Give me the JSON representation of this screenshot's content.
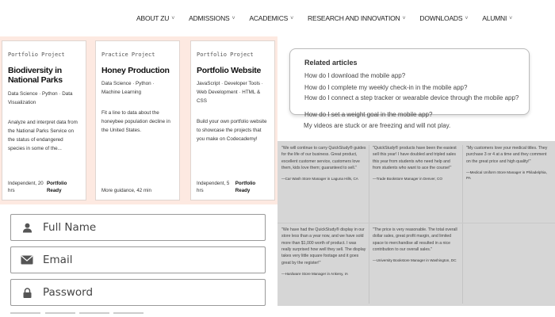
{
  "nav": {
    "items": [
      {
        "label": "ABOUT ZU"
      },
      {
        "label": "ADMISSIONS"
      },
      {
        "label": "ACADEMICS"
      },
      {
        "label": "RESEARCH AND INNOVATION"
      },
      {
        "label": "DOWNLOADS"
      },
      {
        "label": "ALUMNI"
      }
    ]
  },
  "portfolio": {
    "cards": [
      {
        "kind": "Portfolio Project",
        "title": "Biodiversity in National Parks",
        "skills": "Data Science · Python · Data Visualization",
        "desc": "Analyze and interpret data from the National Parks Service on the status of endangered species in some of the...",
        "meta": "Independent, 20 hrs",
        "badge": "Portfolio Ready"
      },
      {
        "kind": "Practice Project",
        "title": "Honey Production",
        "skills": "Data Science · Python · Machine Learning",
        "desc": "Fit a line to data about the honeybee population decline in the United States.",
        "meta": "More guidance, 42 min",
        "badge": ""
      },
      {
        "kind": "Portfolio Project",
        "title": "Portfolio Website",
        "skills": "JavaScript · Developer Tools · Web Development · HTML & CSS",
        "desc": "Build your own portfolio website to showcase the projects that you make on Codecademy!",
        "meta": "Independent, 5 hrs",
        "badge": "Portfolio Ready"
      }
    ]
  },
  "related": {
    "heading": "Related articles",
    "links": [
      "How do I download the mobile app?",
      "How do I complete my weekly check-in in the mobile app?",
      "How do I connect a step tracker or wearable device through the mobile app?",
      "How do I set a weight goal in the mobile app?",
      "My videos are stuck or are freezing and will not play."
    ]
  },
  "testimonials": [
    {
      "quote": "\"We will continue to carry QuickStudy® guides for the life of our business. Great product, excellent customer service, customers love them, kids love them; guaranteed to sell.\"",
      "sig": "—Car Wash Store Manager in Laguna Hills, CA"
    },
    {
      "quote": "\"QuickStudy® products have been the easiest sell this year! I have doubled and tripled sales this year from students who need help and from students who want to ace the course!\"",
      "sig": "—Trade Bookstore Manager in Denver, CO"
    },
    {
      "quote": "\"My customers love your medical titles. They purchase 3 or 4 at a time and they comment on the great price and high quality!\"",
      "sig": "—Medical Uniform Store Manager in Philadelphia, PA"
    },
    {
      "quote": "\"We have had the QuickStudy® display in our store less than a year now, and we have sold more than $1,000 worth of product. I was really surprised how well they sell. The display takes very little square footage and it goes great by the register!\"",
      "sig": "—Hardware Store Manager in Ankeny, IA"
    },
    {
      "quote": "\"The price is very reasonable. The total overall dollar sales, great profit margin, and limited space to merchandise all resulted in a nice contribution to our overall sales.\"",
      "sig": "—University Bookstore Manager in Washington, DC"
    }
  ],
  "form": {
    "fullname_placeholder": "Full Name",
    "email_placeholder": "Email",
    "password_placeholder": "Password"
  },
  "icons": {
    "user": "user-icon",
    "email": "envelope-icon",
    "password": "lock-icon"
  },
  "colors": {
    "portfolio_bg": "#fde9e1",
    "testimonial_bg": "#d6d6d6"
  }
}
